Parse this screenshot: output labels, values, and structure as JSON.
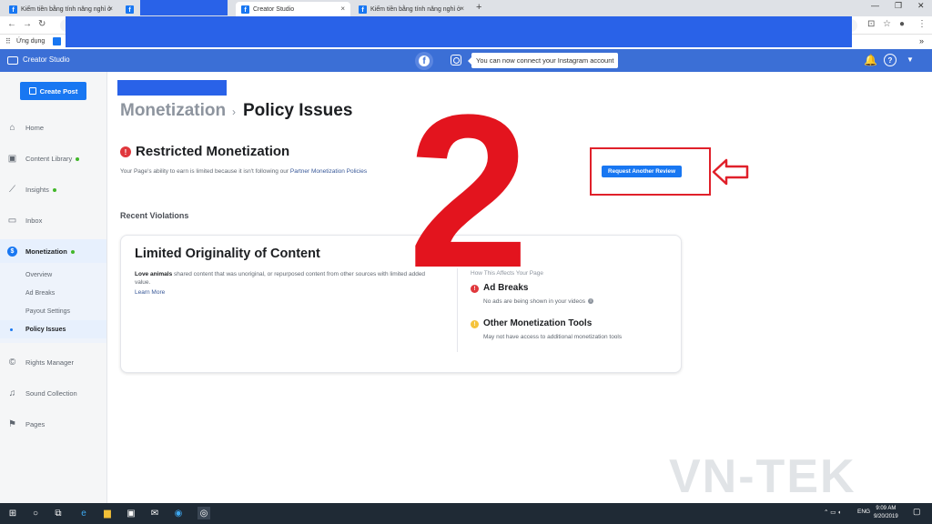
{
  "browser": {
    "tabs": [
      {
        "label": "Kiếm tiền bằng tính năng nghỉ ở",
        "active": false
      },
      {
        "label": "",
        "active": false
      },
      {
        "label": "Creator Studio",
        "active": true
      },
      {
        "label": "Kiếm tiền bằng tính năng nghỉ ở",
        "active": false
      }
    ],
    "tab_close": "×",
    "new_tab": "+",
    "window_controls": {
      "minimize": "—",
      "restore": "❐",
      "close": "✕"
    },
    "bookmarks_label": "Ứng dụng",
    "bookmarks_overflow": "»"
  },
  "header": {
    "app_title": "Creator Studio",
    "facebook_glyph": "f",
    "tooltip": "You can now connect your Instagram account",
    "help_glyph": "?",
    "bell_glyph": "🔔",
    "caret_glyph": "▼"
  },
  "sidebar": {
    "create_post": "Create Post",
    "items": [
      {
        "label": "Home",
        "icon": "home-icon",
        "glyph": "⌂",
        "dot": false
      },
      {
        "label": "Content Library",
        "icon": "library-icon",
        "glyph": "▣",
        "dot": true
      },
      {
        "label": "Insights",
        "icon": "insights-icon",
        "glyph": "⟋",
        "dot": true
      },
      {
        "label": "Inbox",
        "icon": "inbox-icon",
        "glyph": "▭",
        "dot": false
      },
      {
        "label": "Monetization",
        "icon": "monetization-icon",
        "glyph": "$",
        "dot": true
      },
      {
        "label": "Rights Manager",
        "icon": "rights-icon",
        "glyph": "©",
        "dot": false
      },
      {
        "label": "Sound Collection",
        "icon": "sound-icon",
        "glyph": "♫",
        "dot": false
      },
      {
        "label": "Pages",
        "icon": "pages-icon",
        "glyph": "⚑",
        "dot": false
      }
    ],
    "monetization_sub": [
      "Overview",
      "Ad Breaks",
      "Payout Settings",
      "Policy Issues"
    ]
  },
  "main": {
    "breadcrumb_parent": "Monetization",
    "breadcrumb_sep": "›",
    "breadcrumb_current": "Policy Issues",
    "alert_glyph": "!",
    "restricted_title": "Restricted Monetization",
    "restricted_desc": "Your Page's ability to earn is limited because it isn't following our",
    "restricted_link": "Partner Monetization Policies",
    "request_button": "Request Another Review",
    "recent_violations": "Recent Violations",
    "violation": {
      "title": "Limited Originality of Content",
      "desc_bold": "Love animals",
      "desc": "shared content that was unoriginal, or repurposed content from other sources with limited added value.",
      "learn_more": "Learn More",
      "effects_header": "How This Affects Your Page",
      "effects": [
        {
          "title": "Ad Breaks",
          "desc": "No ads are being shown in your videos",
          "color": "#e0373c"
        },
        {
          "title": "Other Monetization Tools",
          "desc": "May not have access to additional monetization tools",
          "color": "#f5c33b"
        }
      ]
    }
  },
  "overlay": {
    "big_number": "2",
    "watermark": "VN-TEK"
  },
  "taskbar": {
    "language": "ENG",
    "time": "9:09 AM",
    "date": "9/20/2019"
  },
  "colors": {
    "accent": "#1877f2",
    "header": "#3b6fd6",
    "annotation": "#e0202a"
  }
}
